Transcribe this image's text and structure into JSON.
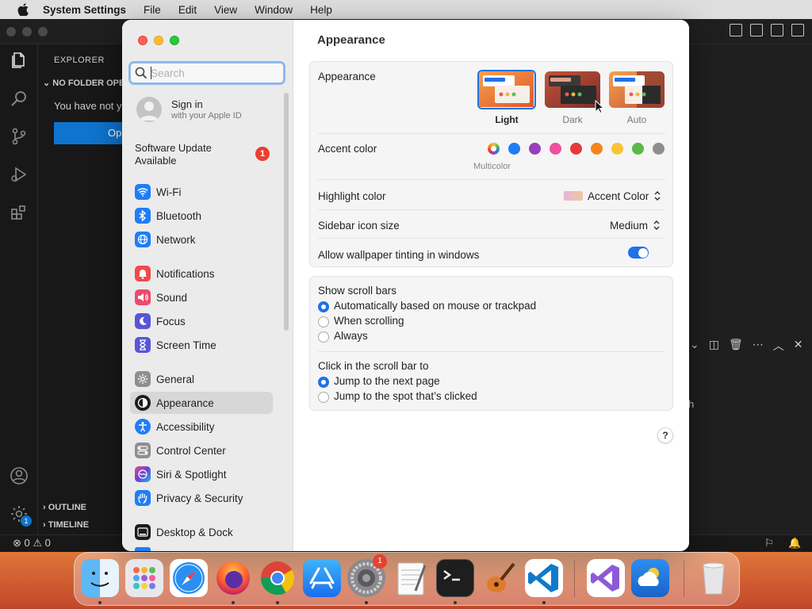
{
  "menubar": {
    "app_name": "System Settings",
    "items": [
      "File",
      "Edit",
      "View",
      "Window",
      "Help"
    ]
  },
  "vscode": {
    "explorer_title": "EXPLORER",
    "no_folder": "NO FOLDER OPE",
    "not_opened": "You have not y",
    "open_button": "Op",
    "outline": "OUTLINE",
    "timeline": "TIMELINE",
    "status_errors": "0",
    "status_warnings": "0",
    "gear_badge": "1",
    "panel_text": "h"
  },
  "settings": {
    "search_placeholder": "Search",
    "sign_in": {
      "title": "Sign in",
      "subtitle": "with your Apple ID"
    },
    "software_update": {
      "label": "Software Update Available",
      "badge": "1"
    },
    "nav": [
      {
        "label": "Wi-Fi",
        "icon": "wifi-icon",
        "color": "#1f7ef7"
      },
      {
        "label": "Bluetooth",
        "icon": "bluetooth-icon",
        "color": "#1f7ef7"
      },
      {
        "label": "Network",
        "icon": "globe-icon",
        "color": "#1f7ef7"
      },
      {
        "label": "Notifications",
        "icon": "bell-icon",
        "color": "#ef4a4a"
      },
      {
        "label": "Sound",
        "icon": "speaker-icon",
        "color": "#ef4a6a"
      },
      {
        "label": "Focus",
        "icon": "moon-icon",
        "color": "#5856d6"
      },
      {
        "label": "Screen Time",
        "icon": "hourglass-icon",
        "color": "#5856d6"
      },
      {
        "label": "General",
        "icon": "gear-icon",
        "color": "#8e8e93"
      },
      {
        "label": "Appearance",
        "icon": "appearance-icon",
        "color": "#1c1c1e"
      },
      {
        "label": "Accessibility",
        "icon": "accessibility-icon",
        "color": "#1f7ef7"
      },
      {
        "label": "Control Center",
        "icon": "control-center-icon",
        "color": "#8e8e93"
      },
      {
        "label": "Siri & Spotlight",
        "icon": "siri-icon",
        "color": "#8b3fd6"
      },
      {
        "label": "Privacy & Security",
        "icon": "hand-icon",
        "color": "#1f7ef7"
      },
      {
        "label": "Desktop & Dock",
        "icon": "dock-icon",
        "color": "#1c1c1e"
      }
    ],
    "main": {
      "title": "Appearance",
      "appearance_label": "Appearance",
      "modes": [
        "Light",
        "Dark",
        "Auto"
      ],
      "accent_label": "Accent color",
      "multicolor_label": "Multicolor",
      "accent_colors": [
        "#1f7ef7",
        "#9b3fb8",
        "#ee4fa2",
        "#e5393b",
        "#f48520",
        "#f7c534",
        "#5bb947",
        "#8e8e8e"
      ],
      "highlight_label": "Highlight color",
      "highlight_value": "Accent Color",
      "sidebar_icon_label": "Sidebar icon size",
      "sidebar_icon_value": "Medium",
      "tinting_label": "Allow wallpaper tinting in windows",
      "scroll_title": "Show scroll bars",
      "scroll_options": [
        "Automatically based on mouse or trackpad",
        "When scrolling",
        "Always"
      ],
      "click_title": "Click in the scroll bar to",
      "click_options": [
        "Jump to the next page",
        "Jump to the spot that’s clicked"
      ],
      "help": "?"
    }
  },
  "dock": {
    "settings_badge": "1"
  }
}
